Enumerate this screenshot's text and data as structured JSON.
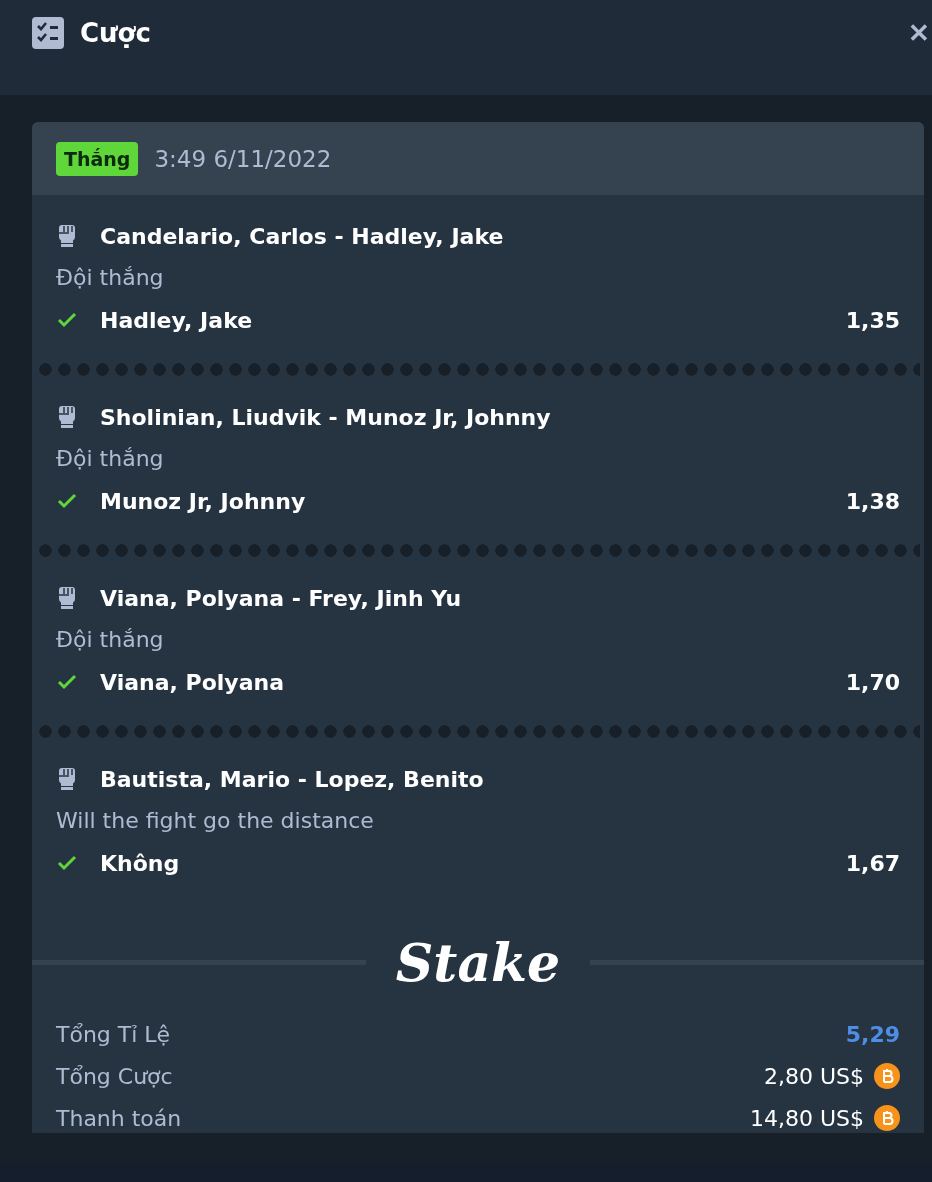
{
  "header": {
    "title": "Cược",
    "close": "✕"
  },
  "bet": {
    "status": "Thắng",
    "time": "3:49 6/11/2022",
    "selections": [
      {
        "event": "Candelario, Carlos - Hadley, Jake",
        "market": "Đội thắng",
        "pick": "Hadley, Jake",
        "odds": "1,35",
        "won": true
      },
      {
        "event": "Sholinian, Liudvik - Munoz Jr, Johnny",
        "market": "Đội thắng",
        "pick": "Munoz Jr, Johnny",
        "odds": "1,38",
        "won": true
      },
      {
        "event": "Viana, Polyana - Frey, Jinh Yu",
        "market": "Đội thắng",
        "pick": "Viana, Polyana",
        "odds": "1,70",
        "won": true
      },
      {
        "event": "Bautista, Mario - Lopez, Benito",
        "market": "Will the fight go the distance",
        "pick": "Không",
        "odds": "1,67",
        "won": true
      }
    ],
    "logo": "Stake",
    "summary": [
      {
        "label": "Tổng Tỉ Lệ",
        "value": "5,29",
        "kind": "odds"
      },
      {
        "label": "Tổng Cược",
        "value": "2,80 US$",
        "kind": "currency"
      },
      {
        "label": "Thanh toán",
        "value": "14,80 US$",
        "kind": "currency"
      }
    ]
  }
}
